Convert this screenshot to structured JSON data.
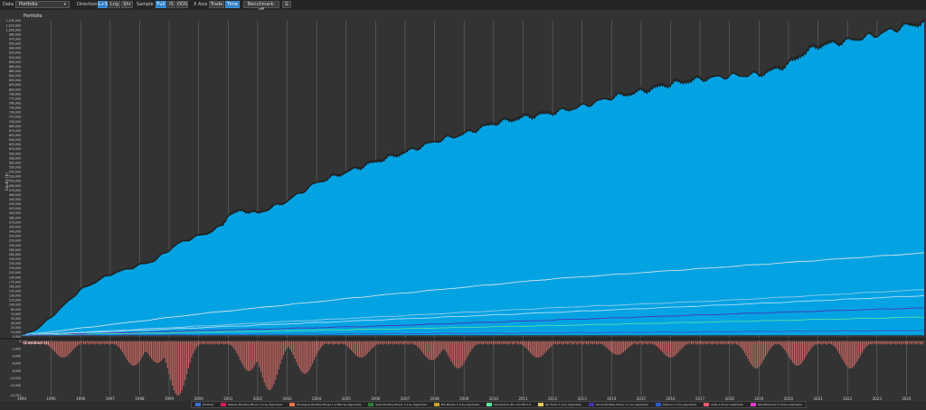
{
  "toolbar": {
    "data_label": "Data",
    "data_value": "Portfolio",
    "direction_label": "Direction",
    "direction_options": [
      "L+S",
      "Lng",
      "Shr"
    ],
    "sample_label": "Sample",
    "sample_options": [
      "Full",
      "IS",
      "OOS"
    ],
    "xaxis_label": "X Axis",
    "xaxis_options": [
      "Trade",
      "Time"
    ],
    "benchmark_label": "Benchmark: off",
    "menu_icon": "menu-icon"
  },
  "chart_data": {
    "type": "area",
    "title": "Portfolio",
    "ylabel": "Equity ($)",
    "y_ticks": [
      "1,030,000",
      "1,015,000",
      "1,000,000",
      "985,000",
      "970,000",
      "955,000",
      "940,000",
      "925,000",
      "910,000",
      "895,000",
      "880,000",
      "865,000",
      "850,000",
      "835,000",
      "820,000",
      "805,000",
      "790,000",
      "775,000",
      "760,000",
      "745,000",
      "730,000",
      "715,000",
      "700,000",
      "685,000",
      "670,000",
      "655,000",
      "640,000",
      "625,000",
      "610,000",
      "595,000",
      "580,000",
      "565,000",
      "550,000",
      "535,000",
      "520,000",
      "505,000",
      "490,000",
      "475,000",
      "460,000",
      "445,000",
      "430,000",
      "415,000",
      "400,000",
      "385,000",
      "370,000",
      "355,000",
      "340,000",
      "325,000",
      "310,000",
      "295,000",
      "280,000",
      "265,000",
      "250,000",
      "235,000",
      "220,000",
      "205,000",
      "190,000",
      "175,000",
      "160,000",
      "145,000",
      "130,000",
      "115,000",
      "100,000",
      "85,000",
      "70,000",
      "55,000",
      "40,000",
      "25,000",
      "10,000",
      "-5,000"
    ],
    "ylim": [
      -5000,
      1030000
    ],
    "x_ticks": [
      "1994",
      "1995",
      "1996",
      "1997",
      "1998",
      "1999",
      "2000",
      "2001",
      "2002",
      "2003",
      "2004",
      "2005",
      "2006",
      "2007",
      "2008",
      "2009",
      "2010",
      "2011",
      "2012",
      "2013",
      "2014",
      "2015",
      "2016",
      "2017",
      "2018",
      "2019",
      "2020",
      "2021",
      "2022",
      "2023",
      "2024"
    ],
    "xlim": [
      1994.0,
      2024.6
    ],
    "portfolio": {
      "name": "Portfolio",
      "color": "#03a3e3",
      "x": [
        1994.0,
        1994.5,
        1995.0,
        1995.5,
        1996.0,
        1996.5,
        1997.0,
        1997.5,
        1998.0,
        1998.5,
        1999.0,
        1999.3,
        1999.8,
        2000.3,
        2000.8,
        2001.0,
        2001.5,
        2002.0,
        2002.5,
        2003.0,
        2003.5,
        2004.0,
        2005.0,
        2006.0,
        2007.0,
        2008.0,
        2009.0,
        2010.0,
        2011.0,
        2012.0,
        2013.0,
        2014.0,
        2015.0,
        2016.0,
        2017.0,
        2018.0,
        2019.0,
        2019.5,
        2020.0,
        2020.5,
        2021.0,
        2022.0,
        2023.0,
        2024.0,
        2024.6
      ],
      "y": [
        0,
        20000,
        60000,
        105000,
        150000,
        175000,
        200000,
        215000,
        230000,
        245000,
        280000,
        300000,
        320000,
        335000,
        360000,
        395000,
        410000,
        400000,
        420000,
        440000,
        470000,
        500000,
        535000,
        570000,
        600000,
        635000,
        660000,
        695000,
        715000,
        730000,
        750000,
        780000,
        800000,
        825000,
        840000,
        850000,
        855000,
        870000,
        890000,
        925000,
        950000,
        965000,
        985000,
        1015000,
        1025000
      ]
    },
    "series": [
      {
        "name": "Steady Monthly Mover 1.2 by Algohaide",
        "color": "#e8e8e8",
        "x": [
          1994,
          2000,
          2006,
          2012,
          2018,
          2024.6
        ],
        "y": [
          0,
          70000,
          130000,
          185000,
          225000,
          270000
        ]
      },
      {
        "name": "Emerging Monthly Mover 1.1 PRO by Algohaide",
        "color": "#9ecde8",
        "x": [
          1994,
          2000,
          2006,
          2012,
          2018,
          2024.6
        ],
        "y": [
          0,
          30000,
          60000,
          90000,
          115000,
          150000
        ]
      },
      {
        "name": "Gold Monthly Mover 1.1 by Algohaide",
        "color": "#bfe3f5",
        "x": [
          1994,
          2000,
          2006,
          2012,
          2018,
          2024.6
        ],
        "y": [
          0,
          25000,
          50000,
          75000,
          100000,
          130000
        ]
      },
      {
        "name": "Stock Monthly Mover 1.1 by Algohaide",
        "color": "#4a2fb0",
        "x": [
          1994,
          2000,
          2006,
          2012,
          2018,
          2024.6
        ],
        "y": [
          0,
          15000,
          30000,
          50000,
          70000,
          90000
        ]
      },
      {
        "name": "Momentum IEC 1x3 ETs 1.0",
        "color": "#5be3a0",
        "x": [
          1994,
          2000,
          2006,
          2012,
          2018,
          2024.6
        ],
        "y": [
          0,
          10000,
          20000,
          32000,
          45000,
          60000
        ]
      },
      {
        "name": "Triple-S 1.3 by Algohaide",
        "color": "#2f58c9",
        "x": [
          1994,
          2000,
          2006,
          2012,
          2018,
          2024.6
        ],
        "y": [
          0,
          2000,
          5000,
          8000,
          12000,
          16000
        ]
      }
    ],
    "drawdown": {
      "title": "Drawdown ($)",
      "color": "#c96762",
      "y_ticks": [
        "0",
        "-2,000",
        "-4,000",
        "-6,000",
        "-8,000",
        "-10,000",
        "-12,000",
        "-14,721"
      ],
      "ylim": [
        -14721,
        0
      ],
      "min_value": -14721
    },
    "legend": [
      {
        "name": "Portfolio",
        "color": "#3a6fd6"
      },
      {
        "name": "Steady Monthly Mover 1.2 by Algohaide",
        "color": "#d81b60"
      },
      {
        "name": "Emerging Monthly Mover 1.1 PRO by Algohaide",
        "color": "#e8764a"
      },
      {
        "name": "Gold Monthly Mover 1.1 by Algohaide",
        "color": "#2e7d32"
      },
      {
        "name": "IEG Master 1.0 by Algohaide",
        "color": "#c9a227"
      },
      {
        "name": "Momentum IEC 1x3 ETs 1.0",
        "color": "#5be3a0"
      },
      {
        "name": "NC Turbo 1.4 by Algohaide",
        "color": "#e3c85b"
      },
      {
        "name": "Stock Monthly Mover 1.1 by Algohaide",
        "color": "#4a2fb0"
      },
      {
        "name": "Triple-S 1.3 by Algohaide",
        "color": "#2f58c9"
      },
      {
        "name": "Volta 1.03 by Algohaide",
        "color": "#e85a71"
      },
      {
        "name": "WorldExplorer 1.03 by Algohaide",
        "color": "#e03ad0"
      }
    ]
  }
}
